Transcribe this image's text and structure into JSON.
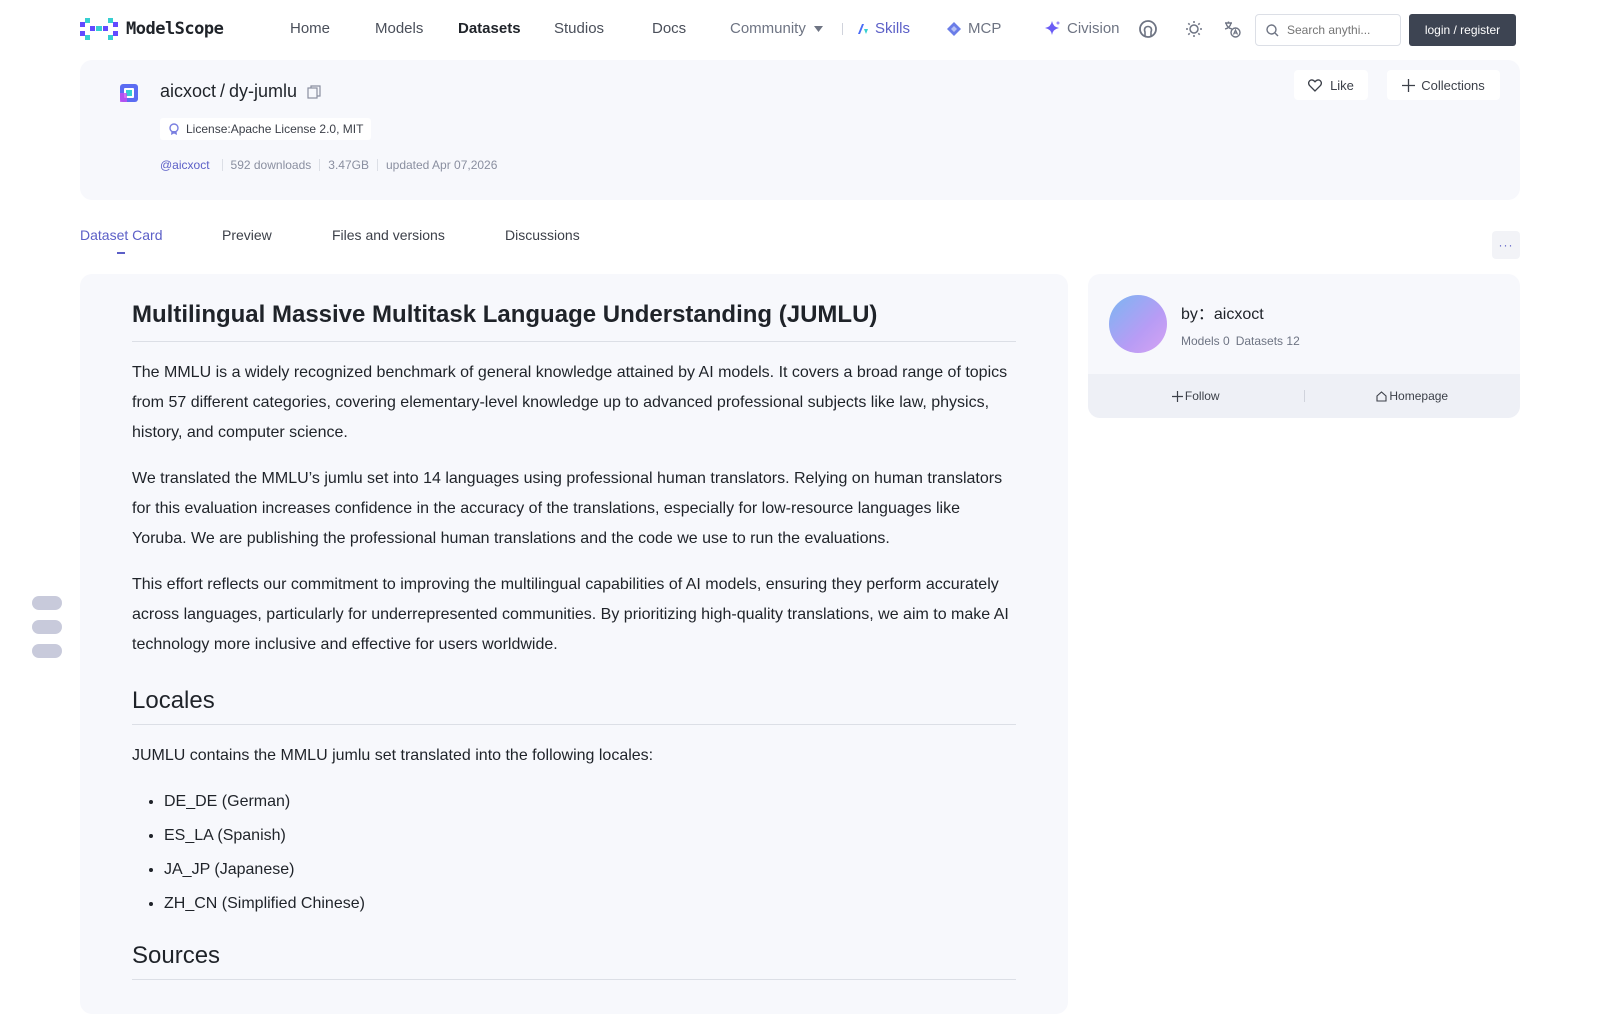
{
  "nav": {
    "brand": "ModelScope",
    "items": [
      {
        "label": "Home"
      },
      {
        "label": "Models"
      },
      {
        "label": "Datasets"
      },
      {
        "label": "Studios"
      },
      {
        "label": "Docs"
      },
      {
        "label": "Community"
      },
      {
        "label": "Skills"
      },
      {
        "label": "MCP"
      },
      {
        "label": "Civision"
      }
    ],
    "search_placeholder": "Search anythi...",
    "login_label": "login / register",
    "icons": [
      "github-icon",
      "theme-toggle-icon",
      "language-icon",
      "search-icon"
    ]
  },
  "repo": {
    "owner": "aicxoct",
    "separator": "/",
    "name": "dy-jumlu",
    "license": "License:Apache License 2.0, MIT",
    "author_handle": "@aicxoct",
    "downloads": "592 downloads",
    "size": "3.47GB",
    "updated": "updated Apr 07,2026",
    "like_label": "Like",
    "collections_label": "Collections"
  },
  "tabs": [
    {
      "label": "Dataset Card",
      "active": true
    },
    {
      "label": "Preview"
    },
    {
      "label": "Files and versions"
    },
    {
      "label": "Discussions"
    }
  ],
  "more_label": "···",
  "card": {
    "title": "Multilingual Massive Multitask Language Understanding (JUMLU)",
    "p1": "The MMLU is a widely recognized benchmark of general knowledge attained by AI models. It covers a broad range of topics from 57 different categories, covering elementary-level knowledge up to advanced professional subjects like law, physics, history, and computer science.",
    "p2": "We translated the MMLU’s jumlu set into 14 languages using professional human translators. Relying on human translators for this evaluation increases confidence in the accuracy of the translations, especially for low-resource languages like Yoruba. We are publishing the professional human translations and the code we use to run the evaluations.",
    "p3": "This effort reflects our commitment to improving the multilingual capabilities of AI models, ensuring they perform accurately across languages, particularly for underrepresented communities. By prioritizing high-quality translations, we aim to make AI technology more inclusive and effective for users worldwide.",
    "locales_heading": "Locales",
    "locales_intro": "JUMLU contains the MMLU jumlu set translated into the following locales:",
    "locales": [
      "DE_DE (German)",
      "ES_LA (Spanish)",
      "JA_JP (Japanese)",
      "ZH_CN (Simplified Chinese)"
    ],
    "sources_heading": "Sources"
  },
  "author": {
    "by_prefix": "by：",
    "name": "aicxoct",
    "models": "Models 0",
    "datasets": "Datasets 12",
    "follow_label": "Follow",
    "homepage_label": "Homepage"
  },
  "colors": {
    "accent": "#5b5fc7",
    "card_bg": "#f7f8fc",
    "login_bg": "#3d4452"
  }
}
